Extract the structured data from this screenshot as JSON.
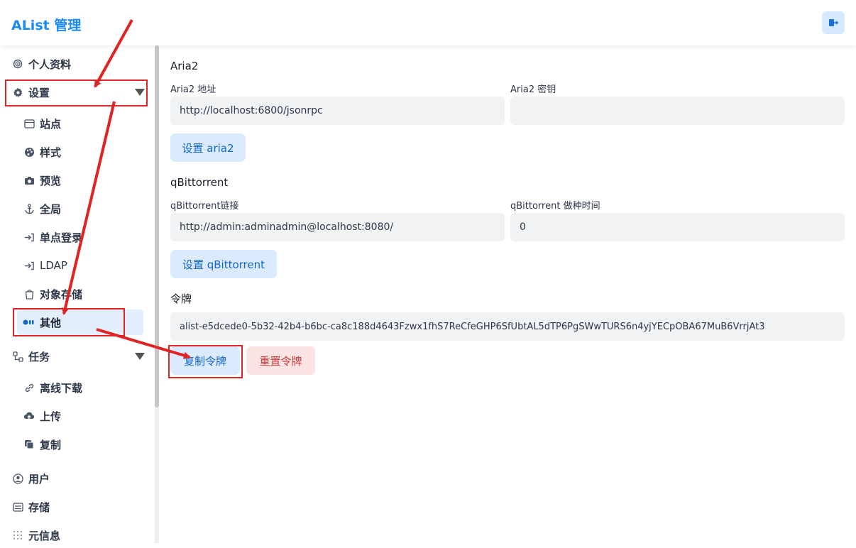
{
  "header": {
    "brand": "AList 管理"
  },
  "sidebar": {
    "items": [
      {
        "label": "个人资料",
        "icon": "fingerprint-icon"
      },
      {
        "label": "设置",
        "icon": "gear-icon"
      },
      {
        "label": "站点",
        "icon": "window-icon"
      },
      {
        "label": "样式",
        "icon": "palette-icon"
      },
      {
        "label": "预览",
        "icon": "camera-icon"
      },
      {
        "label": "全局",
        "icon": "anchor-icon"
      },
      {
        "label": "单点登录",
        "icon": "login-arrow-icon"
      },
      {
        "label": "LDAP",
        "icon": "login-arrow-icon"
      },
      {
        "label": "对象存储",
        "icon": "bucket-icon"
      },
      {
        "label": "其他",
        "icon": "dots-icon"
      },
      {
        "label": "任务",
        "icon": "tasks-icon"
      },
      {
        "label": "离线下载",
        "icon": "link-icon"
      },
      {
        "label": "上传",
        "icon": "cloud-upload-icon"
      },
      {
        "label": "复制",
        "icon": "copy-icon"
      },
      {
        "label": "用户",
        "icon": "user-circle-icon"
      },
      {
        "label": "存储",
        "icon": "storage-icon"
      },
      {
        "label": "元信息",
        "icon": "grid-icon"
      }
    ]
  },
  "main": {
    "aria2": {
      "title": "Aria2",
      "addr_label": "Aria2 地址",
      "addr_value": "http://localhost:6800/jsonrpc",
      "secret_label": "Aria2 密钥",
      "secret_value": "",
      "button": "设置 aria2"
    },
    "qbit": {
      "title": "qBittorrent",
      "url_label": "qBittorrent链接",
      "url_value": "http://admin:adminadmin@localhost:8080/",
      "seed_label": "qBittorrent 做种时间",
      "seed_value": "0",
      "button": "设置 qBittorrent"
    },
    "token": {
      "title": "令牌",
      "value": "alist-e5dcede0-5b32-42b4-b6bc-ca8c188d4643Fzwx1fhS7ReCfeGHP6SfUbtAL5dTP6PgSWwTURS6n4yjYECpOBA67MuB6VrrjAt3",
      "copy_button": "复制令牌",
      "reset_button": "重置令牌"
    }
  },
  "colors": {
    "brand": "#1a8cf0",
    "primary_bg": "#dbeafe",
    "danger_bg": "#fde4e4",
    "annotation": "#e02424"
  }
}
